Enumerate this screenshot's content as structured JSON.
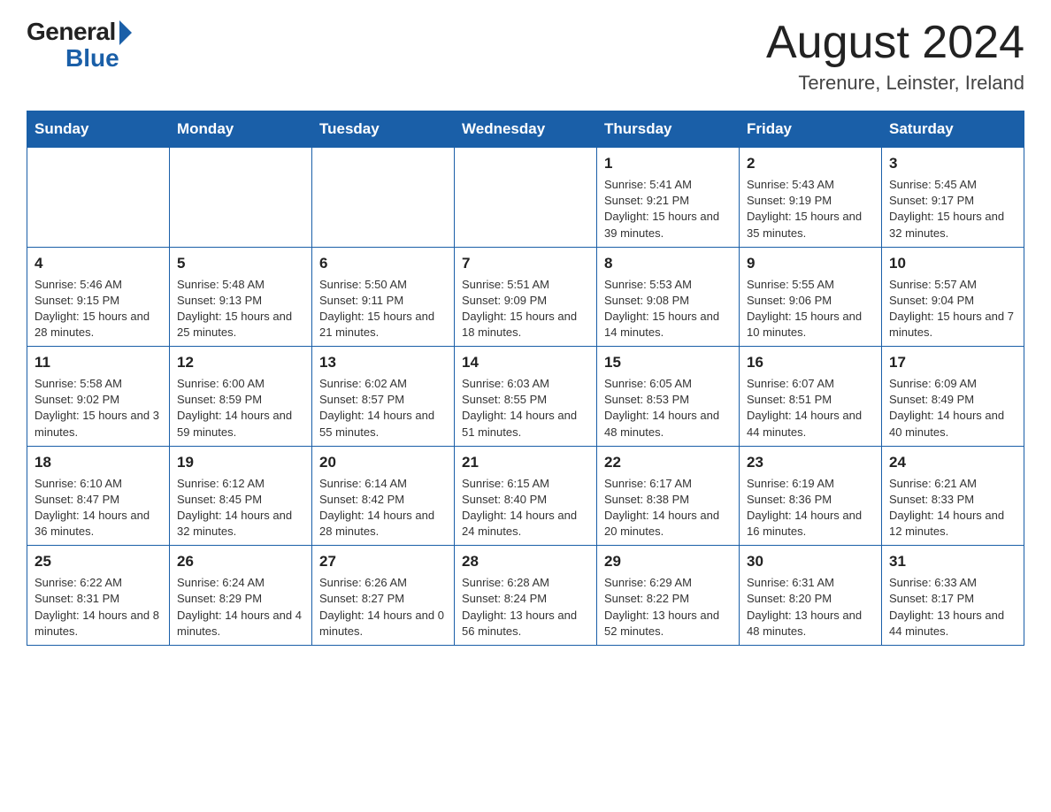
{
  "header": {
    "logo_general": "General",
    "logo_blue": "Blue",
    "month_title": "August 2024",
    "location": "Terenure, Leinster, Ireland"
  },
  "weekdays": [
    "Sunday",
    "Monday",
    "Tuesday",
    "Wednesday",
    "Thursday",
    "Friday",
    "Saturday"
  ],
  "weeks": [
    [
      {
        "day": "",
        "info": ""
      },
      {
        "day": "",
        "info": ""
      },
      {
        "day": "",
        "info": ""
      },
      {
        "day": "",
        "info": ""
      },
      {
        "day": "1",
        "info": "Sunrise: 5:41 AM\nSunset: 9:21 PM\nDaylight: 15 hours and 39 minutes."
      },
      {
        "day": "2",
        "info": "Sunrise: 5:43 AM\nSunset: 9:19 PM\nDaylight: 15 hours and 35 minutes."
      },
      {
        "day": "3",
        "info": "Sunrise: 5:45 AM\nSunset: 9:17 PM\nDaylight: 15 hours and 32 minutes."
      }
    ],
    [
      {
        "day": "4",
        "info": "Sunrise: 5:46 AM\nSunset: 9:15 PM\nDaylight: 15 hours and 28 minutes."
      },
      {
        "day": "5",
        "info": "Sunrise: 5:48 AM\nSunset: 9:13 PM\nDaylight: 15 hours and 25 minutes."
      },
      {
        "day": "6",
        "info": "Sunrise: 5:50 AM\nSunset: 9:11 PM\nDaylight: 15 hours and 21 minutes."
      },
      {
        "day": "7",
        "info": "Sunrise: 5:51 AM\nSunset: 9:09 PM\nDaylight: 15 hours and 18 minutes."
      },
      {
        "day": "8",
        "info": "Sunrise: 5:53 AM\nSunset: 9:08 PM\nDaylight: 15 hours and 14 minutes."
      },
      {
        "day": "9",
        "info": "Sunrise: 5:55 AM\nSunset: 9:06 PM\nDaylight: 15 hours and 10 minutes."
      },
      {
        "day": "10",
        "info": "Sunrise: 5:57 AM\nSunset: 9:04 PM\nDaylight: 15 hours and 7 minutes."
      }
    ],
    [
      {
        "day": "11",
        "info": "Sunrise: 5:58 AM\nSunset: 9:02 PM\nDaylight: 15 hours and 3 minutes."
      },
      {
        "day": "12",
        "info": "Sunrise: 6:00 AM\nSunset: 8:59 PM\nDaylight: 14 hours and 59 minutes."
      },
      {
        "day": "13",
        "info": "Sunrise: 6:02 AM\nSunset: 8:57 PM\nDaylight: 14 hours and 55 minutes."
      },
      {
        "day": "14",
        "info": "Sunrise: 6:03 AM\nSunset: 8:55 PM\nDaylight: 14 hours and 51 minutes."
      },
      {
        "day": "15",
        "info": "Sunrise: 6:05 AM\nSunset: 8:53 PM\nDaylight: 14 hours and 48 minutes."
      },
      {
        "day": "16",
        "info": "Sunrise: 6:07 AM\nSunset: 8:51 PM\nDaylight: 14 hours and 44 minutes."
      },
      {
        "day": "17",
        "info": "Sunrise: 6:09 AM\nSunset: 8:49 PM\nDaylight: 14 hours and 40 minutes."
      }
    ],
    [
      {
        "day": "18",
        "info": "Sunrise: 6:10 AM\nSunset: 8:47 PM\nDaylight: 14 hours and 36 minutes."
      },
      {
        "day": "19",
        "info": "Sunrise: 6:12 AM\nSunset: 8:45 PM\nDaylight: 14 hours and 32 minutes."
      },
      {
        "day": "20",
        "info": "Sunrise: 6:14 AM\nSunset: 8:42 PM\nDaylight: 14 hours and 28 minutes."
      },
      {
        "day": "21",
        "info": "Sunrise: 6:15 AM\nSunset: 8:40 PM\nDaylight: 14 hours and 24 minutes."
      },
      {
        "day": "22",
        "info": "Sunrise: 6:17 AM\nSunset: 8:38 PM\nDaylight: 14 hours and 20 minutes."
      },
      {
        "day": "23",
        "info": "Sunrise: 6:19 AM\nSunset: 8:36 PM\nDaylight: 14 hours and 16 minutes."
      },
      {
        "day": "24",
        "info": "Sunrise: 6:21 AM\nSunset: 8:33 PM\nDaylight: 14 hours and 12 minutes."
      }
    ],
    [
      {
        "day": "25",
        "info": "Sunrise: 6:22 AM\nSunset: 8:31 PM\nDaylight: 14 hours and 8 minutes."
      },
      {
        "day": "26",
        "info": "Sunrise: 6:24 AM\nSunset: 8:29 PM\nDaylight: 14 hours and 4 minutes."
      },
      {
        "day": "27",
        "info": "Sunrise: 6:26 AM\nSunset: 8:27 PM\nDaylight: 14 hours and 0 minutes."
      },
      {
        "day": "28",
        "info": "Sunrise: 6:28 AM\nSunset: 8:24 PM\nDaylight: 13 hours and 56 minutes."
      },
      {
        "day": "29",
        "info": "Sunrise: 6:29 AM\nSunset: 8:22 PM\nDaylight: 13 hours and 52 minutes."
      },
      {
        "day": "30",
        "info": "Sunrise: 6:31 AM\nSunset: 8:20 PM\nDaylight: 13 hours and 48 minutes."
      },
      {
        "day": "31",
        "info": "Sunrise: 6:33 AM\nSunset: 8:17 PM\nDaylight: 13 hours and 44 minutes."
      }
    ]
  ]
}
